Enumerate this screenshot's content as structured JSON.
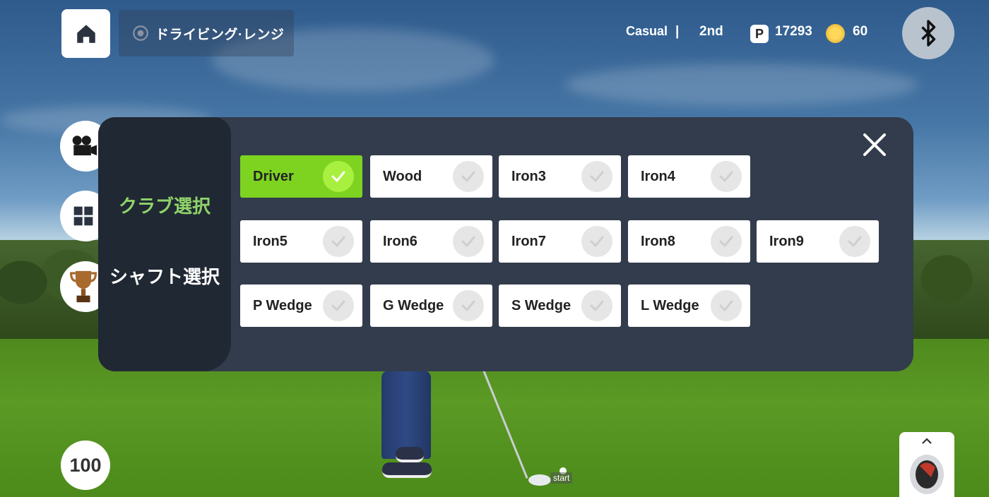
{
  "header": {
    "location": "ドライビング·レンジ",
    "mode": "Casual",
    "separator": "|",
    "rank": "2nd",
    "points_badge": "P",
    "points": "17293",
    "coins": "60"
  },
  "side_buttons": [
    "camera-icon",
    "grid-icon",
    "trophy-icon"
  ],
  "score_badge": "100",
  "scene": {
    "ball_tag": "start"
  },
  "modal": {
    "tabs": [
      {
        "label": "クラブ選択",
        "active": true,
        "color": "#8fd36a"
      },
      {
        "label": "シャフト選択",
        "active": false,
        "color": "#ffffff"
      }
    ],
    "clubs": [
      {
        "label": "Driver",
        "selected": true
      },
      {
        "label": "Wood",
        "selected": false
      },
      {
        "label": "Iron3",
        "selected": false
      },
      {
        "label": "Iron4",
        "selected": false
      },
      {
        "label": "Iron5",
        "selected": false
      },
      {
        "label": "Iron6",
        "selected": false
      },
      {
        "label": "Iron7",
        "selected": false
      },
      {
        "label": "Iron8",
        "selected": false
      },
      {
        "label": "Iron9",
        "selected": false
      },
      {
        "label": "P Wedge",
        "selected": false
      },
      {
        "label": "G Wedge",
        "selected": false
      },
      {
        "label": "S Wedge",
        "selected": false
      },
      {
        "label": "L Wedge",
        "selected": false
      }
    ],
    "colors": {
      "selected_bg": "#7ed321",
      "panel_bg": "#323c4c",
      "side_bg": "#202833"
    }
  }
}
